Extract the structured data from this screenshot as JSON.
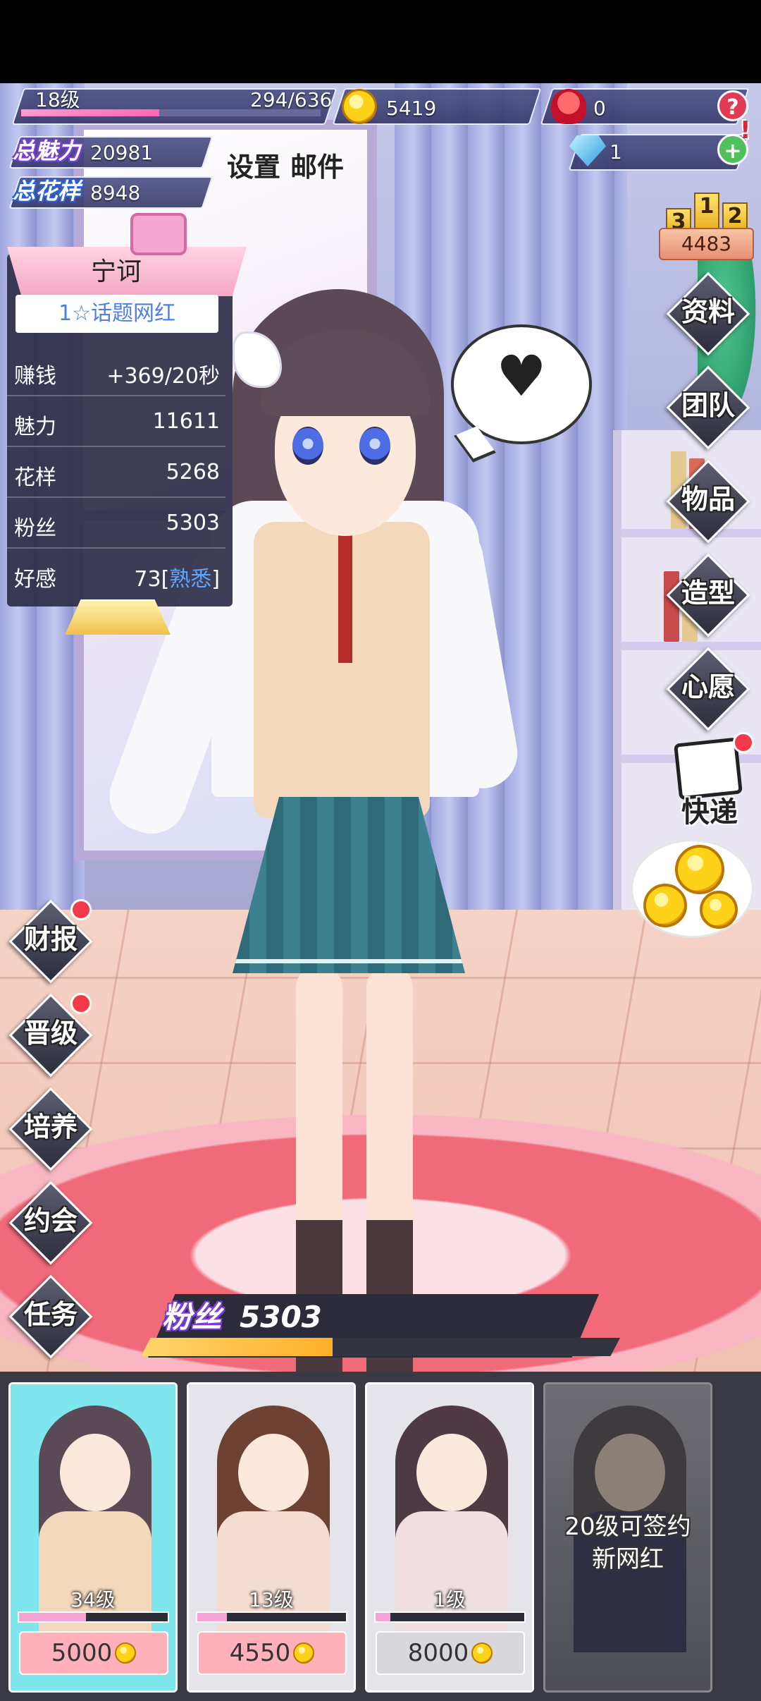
{
  "player": {
    "level": "18级",
    "xp": "294/636",
    "xp_fraction": 0.462,
    "coins": "5419",
    "roses": "0",
    "diamonds": "1",
    "help_symbol": "?",
    "add_symbol": "+",
    "alert_symbol": "!"
  },
  "totals": {
    "charm_label": "总魅力",
    "charm_value": "20981",
    "style_label": "总花样",
    "style_value": "8948"
  },
  "top_buttons": {
    "settings": "设置",
    "mail": "邮件"
  },
  "ranking": {
    "podium": [
      "3",
      "1",
      "2"
    ],
    "value": "4483"
  },
  "character_panel": {
    "name": "宁诃",
    "title": "1☆话题网红",
    "rows": [
      {
        "key": "赚钱",
        "value": "+369/20秒"
      },
      {
        "key": "魅力",
        "value": "11611"
      },
      {
        "key": "花样",
        "value": "5268"
      },
      {
        "key": "粉丝",
        "value": "5303"
      }
    ],
    "affection_key": "好感",
    "affection_value": "73",
    "affection_state": "熟悉"
  },
  "right_menu": [
    "资料",
    "团队",
    "物品",
    "造型",
    "心愿"
  ],
  "express_label": "快递",
  "left_menu": [
    "财报",
    "晋级",
    "培养",
    "约会",
    "任务"
  ],
  "fans": {
    "label": "粉丝",
    "value": "5303",
    "fill_fraction": 0.4
  },
  "cards": [
    {
      "level": "34级",
      "cost": "5000",
      "progress": 0.45,
      "bg": "#7fe6ee",
      "hair": "#5b4a55",
      "body": "#f3d8bb",
      "cost_bg": "#ffb0b8"
    },
    {
      "level": "13级",
      "cost": "4550",
      "progress": 0.2,
      "bg": "#e4e4ea",
      "hair": "#6e4232",
      "body": "#f4dcd1",
      "cost_bg": "#ffb0b8"
    },
    {
      "level": "1级",
      "cost": "8000",
      "progress": 0.1,
      "bg": "#e4e4ea",
      "hair": "#4f3a44",
      "body": "#f0dfe1",
      "cost_bg": "#d8d8dc"
    },
    {
      "lock_text_1": "20级可签约",
      "lock_text_2": "新网红"
    }
  ],
  "colors": {
    "hud_bg": "#4a4d85",
    "accent_pink": "#ff67b4",
    "panel_bg": "#2e2e48",
    "notify_red": "#f23a4a"
  }
}
